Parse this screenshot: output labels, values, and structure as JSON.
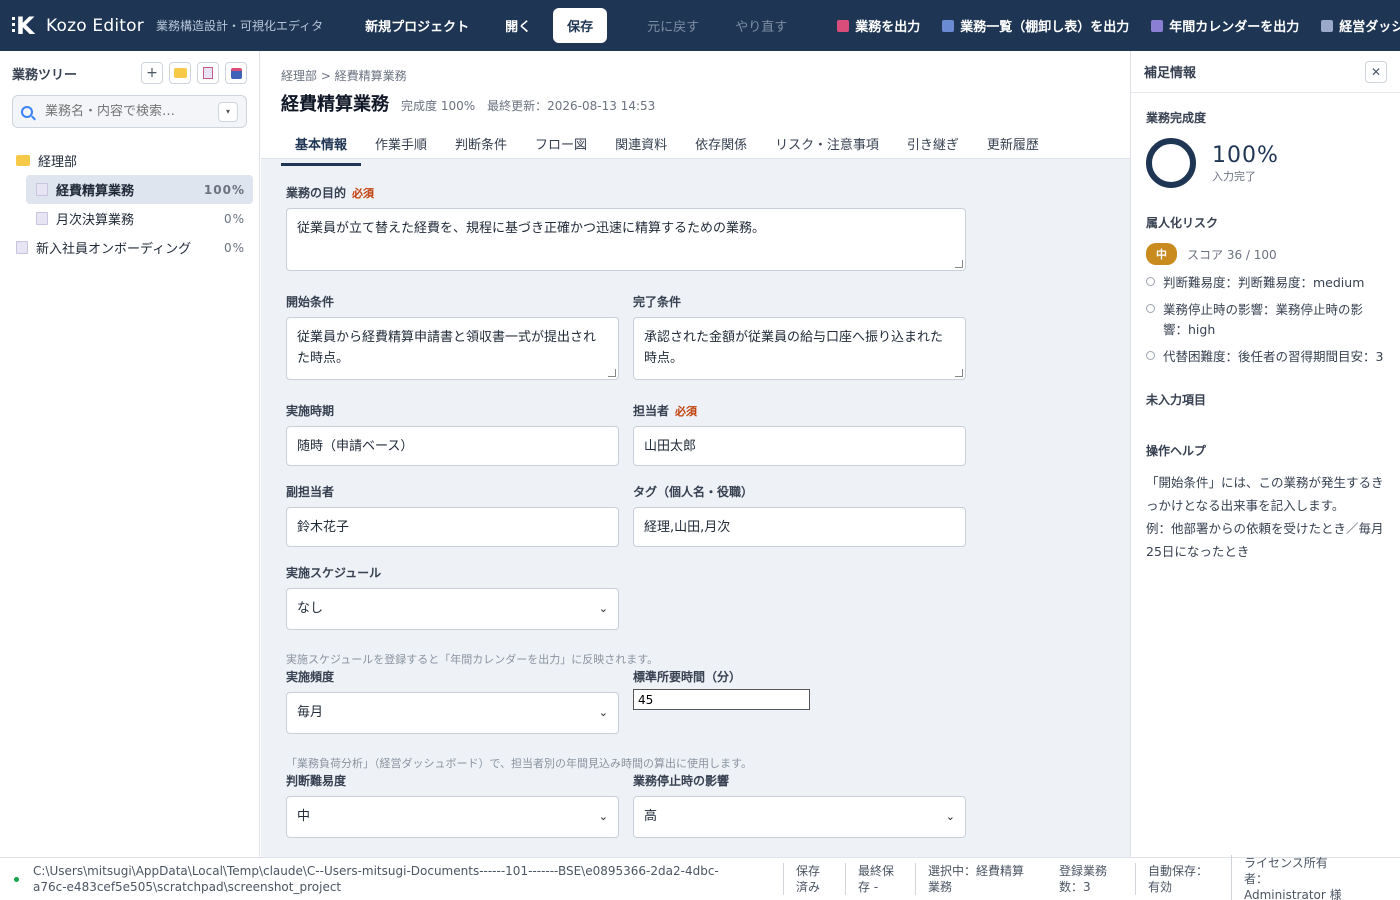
{
  "app": {
    "name": "Kozo Editor",
    "subtitle": "業務構造設計・可視化エディタ"
  },
  "toolbar": {
    "new_project": "新規プロジェクト",
    "open": "開く",
    "save": "保存",
    "undo": "元に戻す",
    "redo": "やり直す",
    "export_task": "業務を出力",
    "export_list": "業務一覧（棚卸し表）を出力",
    "export_calendar": "年間カレンダーを出力",
    "export_dashboard": "経営ダッシュボード",
    "colors": {
      "task": "#d94d7a",
      "list": "#6a8ad4",
      "calendar": "#8b7fd4",
      "dashboard": "#9aa8c9"
    }
  },
  "sidebar": {
    "title": "業務ツリー",
    "buttons": {
      "add": "+"
    },
    "search_placeholder": "業務名・内容で検索…",
    "tree": [
      {
        "label": "経理部",
        "type": "folder",
        "count": ""
      },
      {
        "label": "経費精算業務",
        "type": "doc",
        "count": "100%",
        "selected": true
      },
      {
        "label": "月次決算業務",
        "type": "doc",
        "count": "0%"
      },
      {
        "label": "新入社員オンボーディング",
        "type": "doc",
        "count": "0%"
      }
    ]
  },
  "main": {
    "breadcrumb": "経理部 > 経費精算業務",
    "title": "経費精算業務",
    "completion": "完成度 100%",
    "last_updated": "最終更新：2026-08-13 14:53",
    "tabs": [
      "基本情報",
      "作業手順",
      "判断条件",
      "フロー図",
      "関連資料",
      "依存関係",
      "リスク・注意事項",
      "引き継ぎ",
      "更新履歴"
    ],
    "active_tab": "基本情報",
    "required_label": "必須",
    "fields": {
      "purpose": {
        "label": "業務の目的",
        "value": "従業員が立て替えた経費を、規程に基づき正確かつ迅速に精算するための業務。"
      },
      "start_condition": {
        "label": "開始条件",
        "value": "従業員から経費精算申請書と領収書一式が提出された時点。"
      },
      "end_condition": {
        "label": "完了条件",
        "value": "承認された金額が従業員の給与口座へ振り込まれた時点。"
      },
      "timing": {
        "label": "実施時期",
        "value": "随時（申請ベース）"
      },
      "owner": {
        "label": "担当者",
        "value": "山田太郎"
      },
      "sub_owner": {
        "label": "副担当者",
        "value": "鈴木花子"
      },
      "tags": {
        "label": "タグ（個人名・役職）",
        "value": "経理,山田,月次"
      },
      "schedule": {
        "label": "実施スケジュール",
        "value": "なし",
        "hint": "実施スケジュールを登録すると「年間カレンダーを出力」に反映されます。"
      },
      "frequency": {
        "label": "実施頻度",
        "value": "毎月"
      },
      "std_time": {
        "label": "標準所要時間（分）",
        "value": "45",
        "hint": "「業務負荷分析」（経営ダッシュボード）で、担当者別の年間見込み時間の算出に使用します。"
      },
      "difficulty": {
        "label": "判断難易度",
        "value": "中"
      },
      "impact": {
        "label": "業務停止時の影響",
        "value": "高"
      }
    }
  },
  "panel": {
    "title": "補足情報",
    "completion_label": "業務完成度",
    "completion_value": 100,
    "completion_text": "100%",
    "completion_sub": "入力完了",
    "risk_label": "属人化リスク",
    "risk_badge": "中",
    "risk_score": "スコア 36 / 100",
    "risk_items": [
      "判断難易度：判断難易度：medium",
      "業務停止時の影響：業務停止時の影響：high",
      "代替困難度：後任者の習得期間目安：3"
    ],
    "missing_label": "未入力項目",
    "help_label": "操作ヘルプ",
    "help_text_1": "「開始条件」には、この業務が発生するきっかけとなる出来事を記入します。",
    "help_text_2": "例：他部署からの依頼を受けたとき／毎月25日になったとき"
  },
  "statusbar": {
    "path": "C:\\Users\\mitsugi\\AppData\\Local\\Temp\\claude\\C--Users-mitsugi-Documents------101-------BSE\\e0895366-2da2-4dbc-a76c-e483cef5e505\\scratchpad\\screenshot_project",
    "saved": "保存済み",
    "last_save": "最終保存 -",
    "selected": "選択中：経費精算業務",
    "count": "登録業務数：3",
    "autosave": "自動保存：有効",
    "license": "ライセンス所有者：Administrator 様"
  }
}
